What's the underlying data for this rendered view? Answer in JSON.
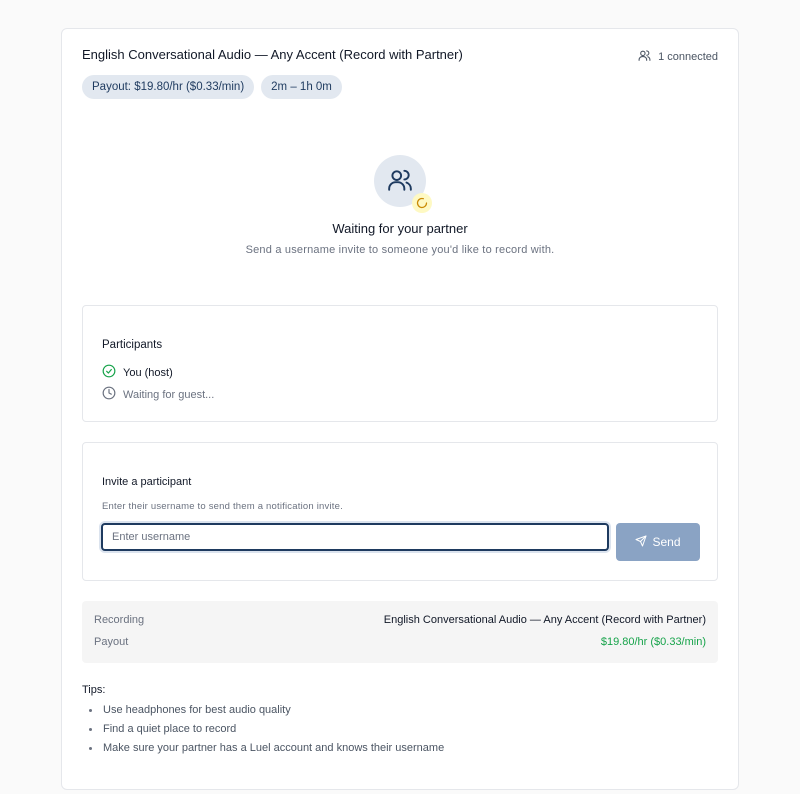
{
  "header": {
    "title": "English Conversational Audio — Any Accent (Record with Partner)",
    "connected_text": "1 connected"
  },
  "pills": [
    {
      "label": "Payout: $19.80/hr ($0.33/min)"
    },
    {
      "label": "2m – 1h 0m"
    }
  ],
  "waiting": {
    "title": "Waiting for your partner",
    "subtitle": "Send a username invite to someone you'd like to record with."
  },
  "participants": {
    "title": "Participants",
    "items": [
      {
        "label": "You (host)",
        "status": "connected"
      },
      {
        "label": "Waiting for guest...",
        "status": "pending"
      }
    ]
  },
  "invite": {
    "title": "Invite a participant",
    "subtitle": "Enter their username to send them a notification invite.",
    "input_value": "",
    "input_placeholder": "Enter username",
    "send_label": "Send"
  },
  "summary": {
    "recording_label": "Recording",
    "recording_value": "English Conversational Audio — Any Accent (Record with Partner)",
    "payout_label": "Payout",
    "payout_value": "$19.80/hr ($0.33/min)"
  },
  "tips": {
    "title": "Tips:",
    "items": [
      "Use headphones for best audio quality",
      "Find a quiet place to record",
      "Make sure your partner has a Luel account and knows their username"
    ]
  },
  "colors": {
    "accent": "#1e3a5f",
    "success": "#16a34a",
    "pending_badge": "#fef9c3",
    "button_disabled": "#8aa3c4"
  }
}
